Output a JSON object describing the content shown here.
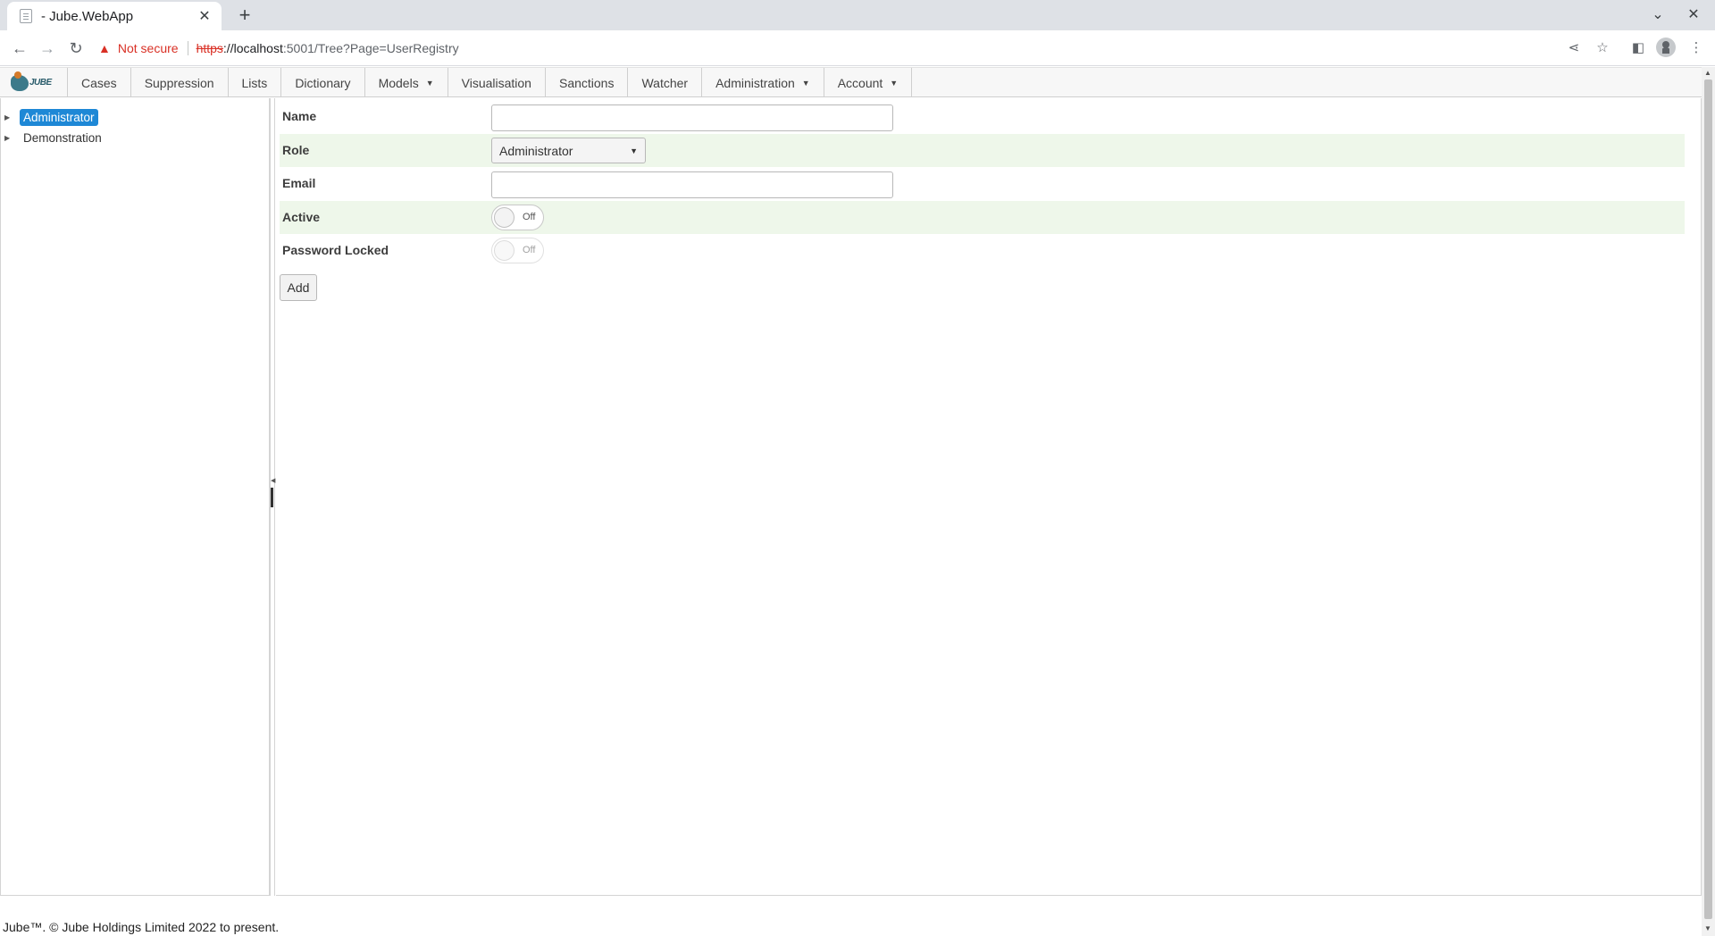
{
  "browser": {
    "tab_title": "- Jube.WebApp",
    "tab_close": "✕",
    "new_tab": "+",
    "security_warning": "Not secure",
    "url_scheme": "https",
    "url_host": "://localhost",
    "url_rest": ":5001/Tree?Page=UserRegistry",
    "minimize": "—",
    "close": "✕",
    "chevron": "⌄"
  },
  "menubar": {
    "logo_text": "JUBE",
    "items": [
      {
        "label": "Cases",
        "has_dropdown": false
      },
      {
        "label": "Suppression",
        "has_dropdown": false
      },
      {
        "label": "Lists",
        "has_dropdown": false
      },
      {
        "label": "Dictionary",
        "has_dropdown": false
      },
      {
        "label": "Models",
        "has_dropdown": true
      },
      {
        "label": "Visualisation",
        "has_dropdown": false
      },
      {
        "label": "Sanctions",
        "has_dropdown": false
      },
      {
        "label": "Watcher",
        "has_dropdown": false
      },
      {
        "label": "Administration",
        "has_dropdown": true
      },
      {
        "label": "Account",
        "has_dropdown": true
      }
    ],
    "caret": "▼"
  },
  "tree": {
    "nodes": [
      {
        "label": "Administrator",
        "selected": true
      },
      {
        "label": "Demonstration",
        "selected": false
      }
    ],
    "toggle": "▶"
  },
  "form": {
    "name_label": "Name",
    "name_value": "",
    "role_label": "Role",
    "role_value": "Administrator",
    "email_label": "Email",
    "email_value": "",
    "active_label": "Active",
    "active_state": "Off",
    "password_locked_label": "Password Locked",
    "password_locked_state": "Off",
    "add_button": "Add"
  },
  "footer": {
    "text": "Jube™. © Jube Holdings Limited 2022 to present."
  },
  "colors": {
    "selected_node": "#1e88d6",
    "alt_row": "#eef7ea",
    "not_secure": "#d93025"
  }
}
